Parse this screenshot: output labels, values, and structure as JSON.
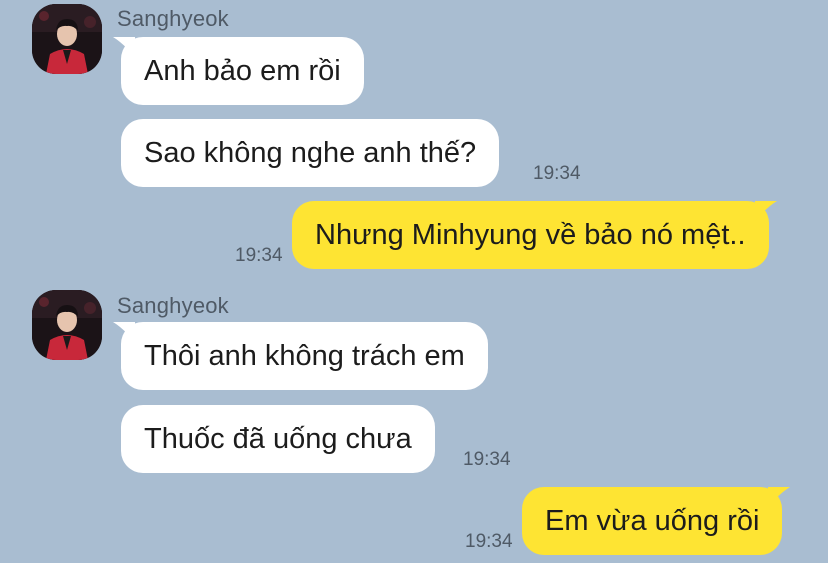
{
  "chat": {
    "messages": [
      {
        "sender": "Sanghyeok",
        "text": "Anh bảo em rồi"
      },
      {
        "text": "Sao không nghe anh thế?",
        "time": "19:34"
      },
      {
        "text": "Nhưng Minhyung về bảo nó mệt..",
        "time": "19:34"
      },
      {
        "sender": "Sanghyeok",
        "text": "Thôi anh không trách em"
      },
      {
        "text": "Thuốc đã uống chưa",
        "time": "19:34"
      },
      {
        "text": "Em vừa uống rồi",
        "time": "19:34"
      }
    ]
  },
  "colors": {
    "background": "#a9bdd1",
    "incoming_bubble": "#ffffff",
    "outgoing_bubble": "#fee433"
  },
  "icons": {
    "avatar": "profile-photo-avatar"
  }
}
